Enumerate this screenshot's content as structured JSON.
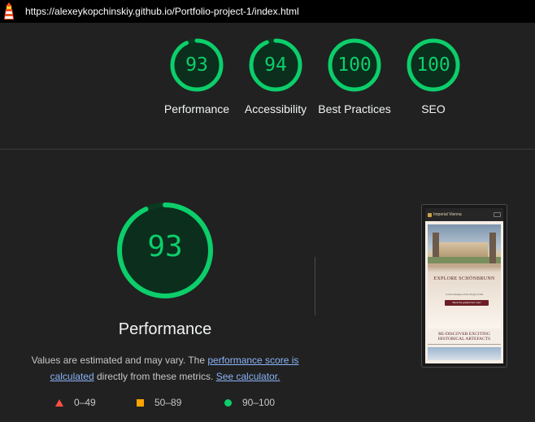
{
  "topbar": {
    "logo_icon": "lighthouse-icon",
    "url": "https://alexeykopchinskiy.github.io/Portfolio-project-1/index.html"
  },
  "categories": [
    {
      "score": "93",
      "label": "Performance",
      "value": 0.93
    },
    {
      "score": "94",
      "label": "Accessibility",
      "value": 0.94
    },
    {
      "score": "100",
      "label": "Best Practices",
      "value": 1.0
    },
    {
      "score": "100",
      "label": "SEO",
      "value": 1.0
    }
  ],
  "detail": {
    "score": "93",
    "value": 0.93,
    "title": "Performance",
    "note_prefix": "Values are estimated and may vary. The ",
    "note_link1": "performance score is calculated",
    "note_middle": " directly from these metrics. ",
    "note_link2": "See calculator."
  },
  "legend": [
    {
      "range": "0–49",
      "shape": "triangle",
      "color": "#ff4e42"
    },
    {
      "range": "50–89",
      "shape": "square",
      "color": "#ffa400"
    },
    {
      "range": "90–100",
      "shape": "circle",
      "color": "#0cce6b"
    }
  ],
  "screenshot": {
    "site_name": "Imperial Vienna",
    "hero_title": "EXPLORE SCHÖNBRUNN",
    "hero_sub": "In the footsteps of the Kings of Old",
    "hero_button": "Book the guided tour now!",
    "section_title": "RE-DISCOVER EXCITING HISTORICAL ARTEFACTS"
  },
  "colors": {
    "pass": "#0cce6b",
    "pass_track": "#0a3a21",
    "background": "#212121",
    "link": "#8ab4f8"
  }
}
